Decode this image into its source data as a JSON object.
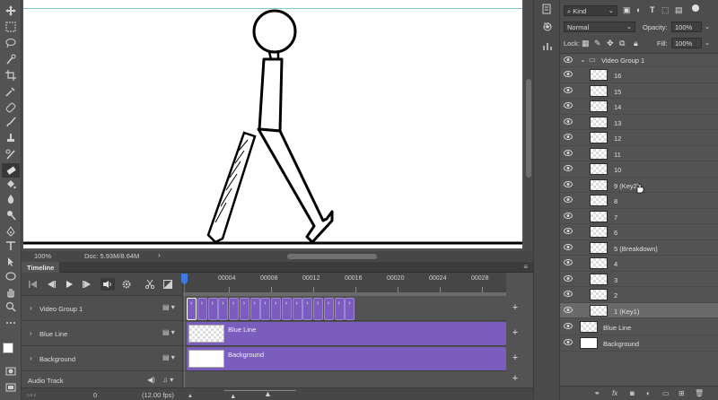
{
  "canvas": {
    "zoom": "100%",
    "doc_info": "Doc: 5.93M/8.64M"
  },
  "timeline": {
    "tab_label": "Timeline",
    "ruler_labels": [
      "00004",
      "00008",
      "00012",
      "00016",
      "00020",
      "00024",
      "00028"
    ],
    "tracks": [
      {
        "name": "Video Group 1",
        "clip_label": ""
      },
      {
        "name": "Blue Line",
        "clip_label": "Blue Line"
      },
      {
        "name": "Background",
        "clip_label": "Background"
      }
    ],
    "audio_track_label": "Audio Track",
    "current_frame": "0",
    "fps_label": "(12.00 fps)",
    "frame_count": 16,
    "accent_color": "#7b5dbd",
    "playhead_color": "#ff3333"
  },
  "layers_panel": {
    "filter_kind": "Kind",
    "blend_mode": "Normal",
    "opacity_label": "Opacity:",
    "opacity_value": "100%",
    "lock_label": "Lock:",
    "fill_label": "Fill:",
    "fill_value": "100%",
    "group_name": "Video Group 1",
    "layers": [
      "16",
      "15",
      "14",
      "13",
      "12",
      "11",
      "10",
      "9 (Key2)",
      "8",
      "7",
      "6",
      "5 (Breakdown)",
      "4",
      "3",
      "2",
      "1 (Key1)"
    ],
    "selected_layer": "1 (Key1)",
    "bottom_layers": [
      "Blue Line",
      "Background"
    ]
  }
}
